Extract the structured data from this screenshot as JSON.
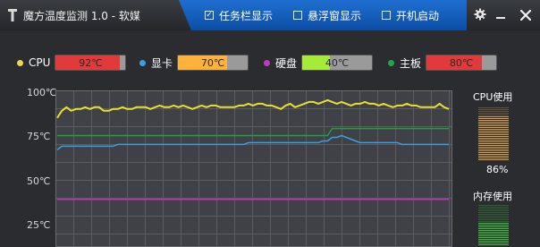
{
  "app": {
    "title": "魔方温度监测 1.0 - 软媒"
  },
  "options": [
    {
      "label": "任务栏显示",
      "checked": true
    },
    {
      "label": "悬浮窗显示",
      "checked": false
    },
    {
      "label": "开机启动",
      "checked": false
    }
  ],
  "window_controls": {
    "settings_icon": "gear-icon",
    "minimize_icon": "minimize-icon",
    "close_icon": "close-icon"
  },
  "sensors": [
    {
      "name": "CPU",
      "value": "92℃",
      "temp": 92,
      "dot_color": "#e8d84a",
      "bar_color": "#e23a3a"
    },
    {
      "name": "显卡",
      "value": "70℃",
      "temp": 70,
      "dot_color": "#3aa0e0",
      "bar_color": "#ffb13a"
    },
    {
      "name": "硬盘",
      "value": "40℃",
      "temp": 40,
      "dot_color": "#c23ac2",
      "bar_color": "#a6ea3a"
    },
    {
      "name": "主板",
      "value": "80℃",
      "temp": 80,
      "dot_color": "#22a64a",
      "bar_color": "#e23a3a"
    }
  ],
  "chart_data": {
    "type": "line",
    "ylim": [
      0,
      100
    ],
    "yticks": [
      "100℃",
      "75℃",
      "50℃",
      "25℃"
    ],
    "grid": true,
    "series": [
      {
        "name": "CPU",
        "color": "#e8e030",
        "values": [
          86,
          90,
          92,
          90,
          91,
          91,
          92,
          91,
          92,
          92,
          90,
          90,
          91,
          91,
          92,
          91,
          91,
          92,
          92,
          92,
          91,
          92,
          93,
          92,
          92,
          93,
          92,
          93,
          92,
          91,
          92,
          93,
          92,
          93,
          93,
          92,
          92,
          92,
          92,
          93,
          93,
          94,
          93,
          94,
          94,
          93,
          93,
          92,
          91,
          93,
          94,
          92,
          93,
          94,
          95,
          95,
          94,
          95,
          96,
          95,
          94,
          95,
          94,
          93,
          94,
          94,
          95,
          94,
          94,
          93,
          94,
          93,
          92,
          93,
          93,
          94,
          93,
          93,
          92,
          92,
          92,
          92,
          94,
          92,
          91
        ]
      },
      {
        "name": "显卡",
        "color": "#3a9ee0",
        "values": [
          68,
          70,
          70,
          70,
          70,
          70,
          70,
          70,
          70,
          70,
          70,
          70,
          70,
          71,
          71,
          71,
          71,
          71,
          71,
          71,
          71,
          71,
          71,
          71,
          71,
          71,
          71,
          71,
          71,
          71,
          71,
          71,
          71,
          71,
          71,
          71,
          71,
          71,
          71,
          71,
          71,
          72,
          72,
          72,
          72,
          72,
          72,
          72,
          72,
          72,
          72,
          72,
          72,
          72,
          72,
          72,
          72,
          73,
          73,
          75,
          75,
          76,
          75,
          74,
          73,
          72,
          72,
          72,
          72,
          72,
          72,
          72,
          72,
          72,
          71,
          71,
          71,
          71,
          71,
          71,
          71,
          71,
          71,
          71,
          71
        ]
      },
      {
        "name": "主板",
        "color": "#22a040",
        "values": [
          76,
          76,
          76,
          76,
          76,
          76,
          76,
          76,
          76,
          76,
          76,
          76,
          76,
          76,
          76,
          76,
          76,
          76,
          76,
          76,
          76,
          76,
          76,
          76,
          76,
          76,
          76,
          76,
          76,
          76,
          76,
          76,
          76,
          76,
          76,
          76,
          76,
          76,
          76,
          76,
          76,
          76,
          76,
          76,
          76,
          76,
          76,
          76,
          76,
          76,
          76,
          76,
          76,
          76,
          76,
          76,
          76,
          76,
          76,
          80,
          80,
          80,
          80,
          80,
          80,
          80,
          80,
          80,
          80,
          80,
          80,
          80,
          80,
          80,
          80,
          80,
          80,
          80,
          80,
          80,
          80,
          80,
          80,
          80,
          80
        ]
      },
      {
        "name": "硬盘",
        "color": "#c030c0",
        "values": [
          40,
          40,
          40,
          40,
          40,
          40,
          40,
          40,
          40,
          40,
          40,
          40,
          40,
          40,
          40,
          40,
          40,
          40,
          40,
          40,
          40,
          40,
          40,
          40,
          40,
          40,
          40,
          40,
          40,
          40,
          40,
          40,
          40,
          40,
          40,
          40,
          40,
          40,
          40,
          40,
          40,
          40,
          40,
          40,
          40,
          40,
          40,
          40,
          40,
          40,
          40,
          40,
          40,
          40,
          40,
          40,
          40,
          40,
          40,
          40,
          40,
          40,
          40,
          40,
          40,
          40,
          40,
          40,
          40,
          40,
          40,
          40,
          40,
          40,
          40,
          40,
          40,
          40,
          40,
          40,
          40,
          40,
          40,
          40,
          40
        ]
      }
    ]
  },
  "meters": {
    "cpu": {
      "title": "CPU使用",
      "value": "86%",
      "level": 0.86,
      "color": "#d8a050"
    },
    "memory": {
      "title": "内存使用",
      "level": 0.6,
      "color": "#40c040"
    }
  }
}
